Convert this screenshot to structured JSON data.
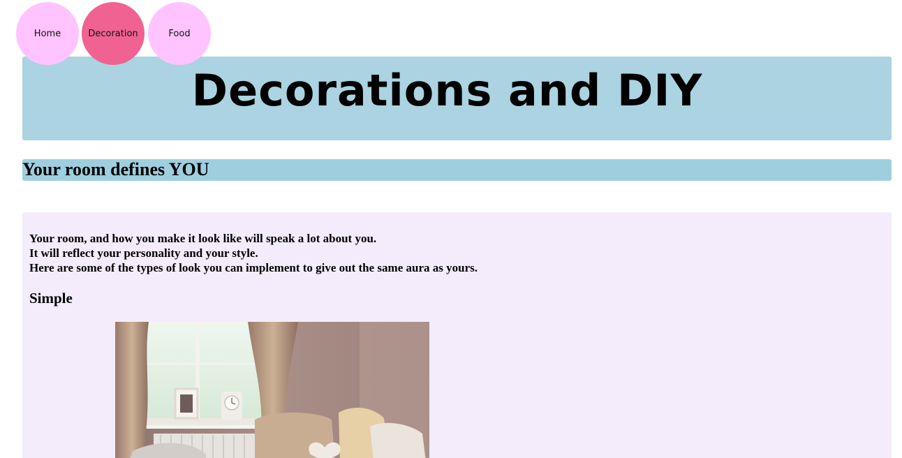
{
  "nav": {
    "items": [
      {
        "label": "Home",
        "active": false
      },
      {
        "label": "Decoration",
        "active": true
      },
      {
        "label": "Food",
        "active": false
      }
    ]
  },
  "banner": {
    "title": "Decorations and DIY"
  },
  "subheader": {
    "title": "Your room defines YOU"
  },
  "content": {
    "intro_lines": [
      "Your room, and how you make it look like will speak a lot about you.",
      "It will reflect your personality and your style.",
      "Here are some of the types of look you can implement to give out the same aura as yours."
    ],
    "section_heading": "Simple"
  },
  "colors": {
    "nav_default": "#ffc4ff",
    "nav_active": "#f06292",
    "banner_bg": "#abd3e1",
    "subheader_bg": "#9fcfdf",
    "content_bg": "#f4ecfa"
  }
}
